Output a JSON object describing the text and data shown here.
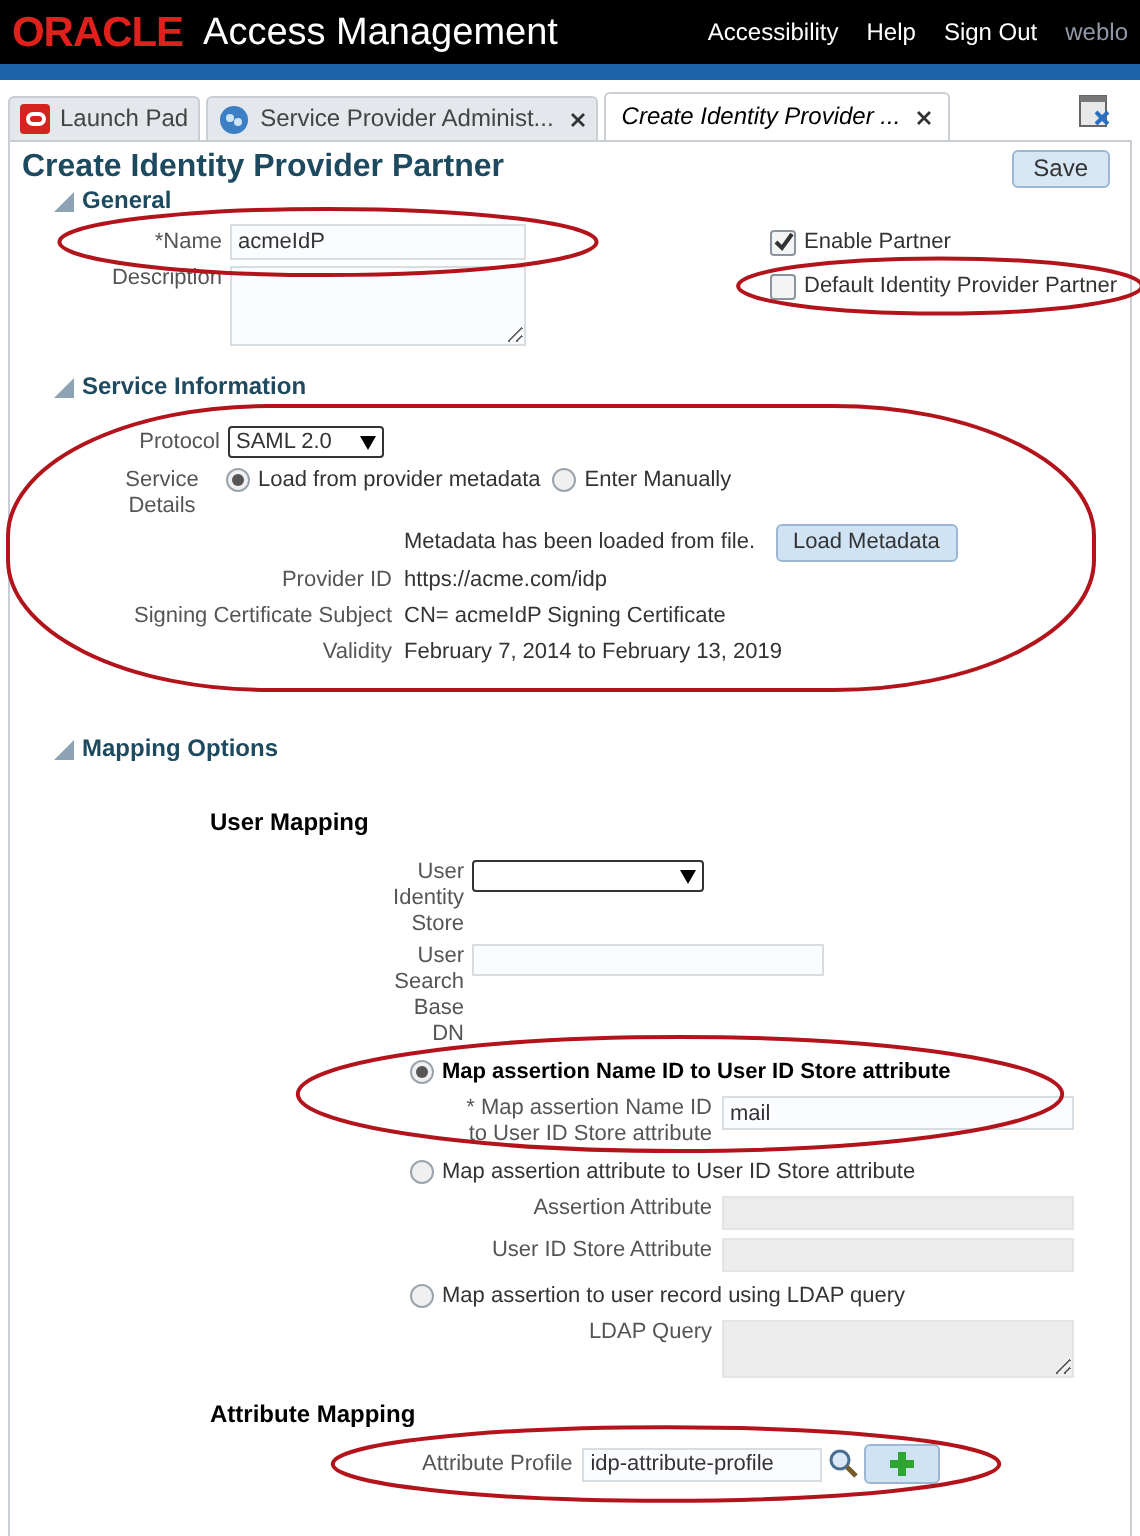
{
  "header": {
    "logo": "ORACLE",
    "title": "Access Management",
    "links": [
      "Accessibility",
      "Help",
      "Sign Out",
      "weblo"
    ]
  },
  "tabs": [
    {
      "label": "Launch Pad",
      "selected": false,
      "closable": false,
      "kind": "launchpad"
    },
    {
      "label": "Service Provider Administ...",
      "selected": false,
      "closable": true,
      "kind": "admin"
    },
    {
      "label": "Create Identity Provider ...",
      "selected": true,
      "closable": true,
      "kind": "page"
    }
  ],
  "page": {
    "title": "Create Identity Provider Partner",
    "save_button": "Save"
  },
  "general": {
    "heading": "General",
    "name": {
      "label": "Name",
      "required_mark": "*",
      "value": "acmeIdP",
      "circled": true
    },
    "description": {
      "label": "Description"
    },
    "checkboxes": [
      {
        "label": "Enable Partner",
        "checked": true
      },
      {
        "label": "Default Identity Provider Partner",
        "checked": false,
        "circled": true
      }
    ]
  },
  "service_information": {
    "heading": "Service Information",
    "circled": true,
    "protocol": {
      "label": "Protocol",
      "value": "SAML 2.0"
    },
    "service_details": {
      "label": "Service Details",
      "options": [
        {
          "label": "Load from provider metadata",
          "selected": true
        },
        {
          "label": "Enter Manually",
          "selected": false
        }
      ]
    },
    "metadata_status": "Metadata has been loaded from file.",
    "load_button": "Load Metadata",
    "fields": [
      {
        "label": "Provider ID",
        "value": "https://acme.com/idp"
      },
      {
        "label": "Signing Certificate Subject",
        "value": "CN= acmeIdP  Signing Certificate"
      },
      {
        "label": "Validity",
        "value": "February 7, 2014 to February 13, 2019"
      }
    ]
  },
  "mapping_options": {
    "heading": "Mapping Options",
    "user_mapping": {
      "heading": "User Mapping",
      "identity_store": {
        "label": "User Identity Store"
      },
      "search_base": {
        "label": "User Search Base DN"
      },
      "options": [
        {
          "label": "Map assertion Name ID to User ID Store attribute",
          "selected": true,
          "circled": true,
          "fields": [
            {
              "label": "Map assertion Name ID to User ID Store attribute",
              "required_mark": "*",
              "value": "mail",
              "kind": "input",
              "disabled": false
            }
          ]
        },
        {
          "label": "Map assertion attribute to User ID Store attribute",
          "selected": false,
          "fields": [
            {
              "label": "Assertion Attribute",
              "kind": "input",
              "disabled": true
            },
            {
              "label": "User ID Store Attribute",
              "kind": "input",
              "disabled": true
            }
          ]
        },
        {
          "label": "Map assertion to user record using LDAP query",
          "selected": false,
          "fields": [
            {
              "label": "LDAP Query",
              "kind": "textarea",
              "disabled": true
            }
          ]
        }
      ]
    },
    "attribute_mapping": {
      "heading": "Attribute Mapping",
      "profile": {
        "label": "Attribute Profile",
        "value": "idp-attribute-profile",
        "circled": true
      }
    }
  }
}
